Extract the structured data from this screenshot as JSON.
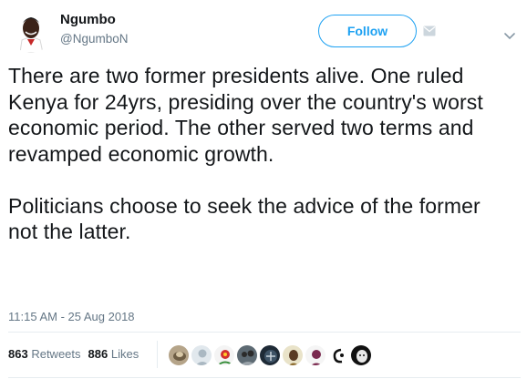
{
  "author": {
    "name": "Ngumbo",
    "handle": "@NgumboN"
  },
  "actions": {
    "follow_label": "Follow"
  },
  "tweet": {
    "paragraph1": "There are two former presidents alive. One ruled Kenya for 24yrs, presiding over the country's worst economic period. The other served two terms and revamped economic growth.",
    "paragraph2": "Politicians choose to seek the advice of the former not the latter.",
    "timestamp": "11:15 AM - 25 Aug 2018"
  },
  "stats": {
    "retweets_count": "863",
    "retweets_label": "Retweets",
    "likes_count": "886",
    "likes_label": "Likes"
  },
  "liker_avatars": [
    "avatar-1",
    "avatar-2",
    "avatar-3",
    "avatar-4",
    "avatar-5",
    "avatar-6",
    "avatar-7",
    "avatar-8",
    "avatar-9"
  ],
  "colors": {
    "accent": "#1da1f2",
    "secondary_text": "#657786",
    "primary_text": "#14171a",
    "border": "#e6ecf0"
  }
}
